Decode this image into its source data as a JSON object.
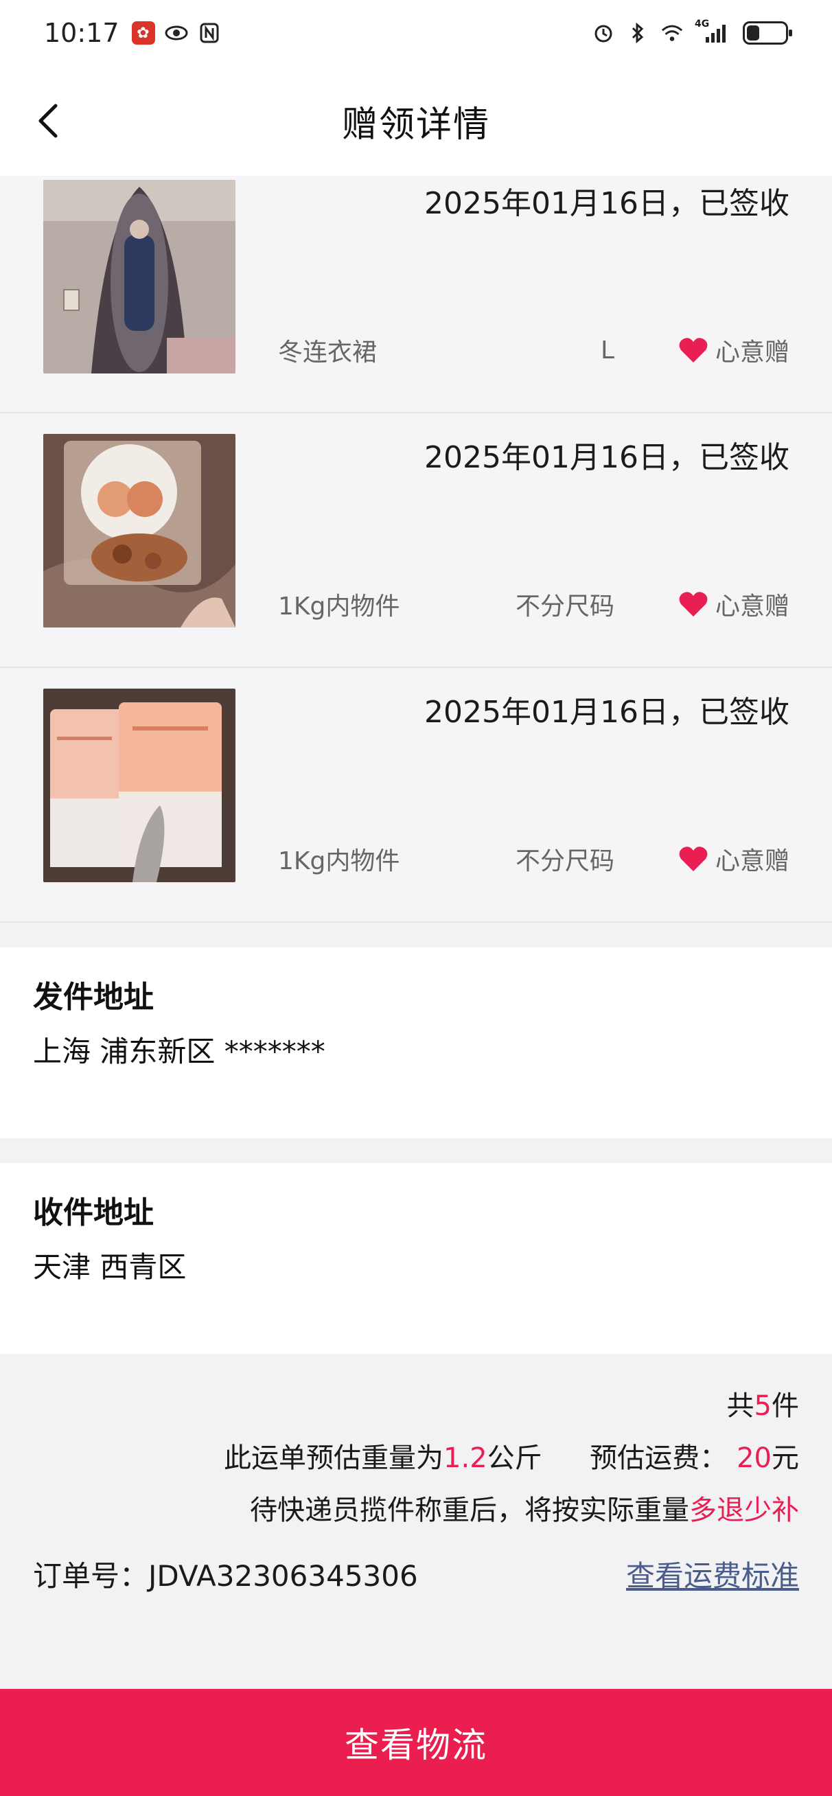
{
  "status_bar": {
    "time": "10:17",
    "network": "4G"
  },
  "header": {
    "title": "赠领详情"
  },
  "items": [
    {
      "date_status": "2025年01月16日，已签收",
      "name": "冬连衣裙",
      "size": "L",
      "tag": "心意赠",
      "thumb_colors": [
        "#4a3f46",
        "#9a8d8a",
        "#2b3a5e"
      ]
    },
    {
      "date_status": "2025年01月16日，已签收",
      "name": "1Kg内物件",
      "size": "不分尺码",
      "tag": "心意赠",
      "thumb_colors": [
        "#6b5049",
        "#c89a6a",
        "#d2b090"
      ]
    },
    {
      "date_status": "2025年01月16日，已签收",
      "name": "1Kg内物件",
      "size": "不分尺码",
      "tag": "心意赠",
      "thumb_colors": [
        "#4d3d36",
        "#f2b9a0",
        "#e8e2df"
      ]
    }
  ],
  "sender": {
    "title": "发件地址",
    "address": "上海 浦东新区 *******"
  },
  "receiver": {
    "title": "收件地址",
    "address": "天津 西青区"
  },
  "summary": {
    "count_prefix": "共",
    "count_value": "5",
    "count_suffix": "件",
    "weight_prefix": "此运单预估重量为",
    "weight_value": "1.2",
    "weight_unit": "公斤",
    "fee_label": "预估运费：",
    "fee_value": "20",
    "fee_unit": "元",
    "notice_prefix": "待快递员揽件称重后，将按实际重量",
    "notice_accent": "多退少补",
    "order_label": "订单号：JDVA32306345306",
    "fee_standard_link": "查看运费标准"
  },
  "bottom_button": {
    "label": "查看物流"
  },
  "colors": {
    "accent": "#e91e53",
    "button": "#ea1f4f",
    "link": "#4a5d8a"
  }
}
